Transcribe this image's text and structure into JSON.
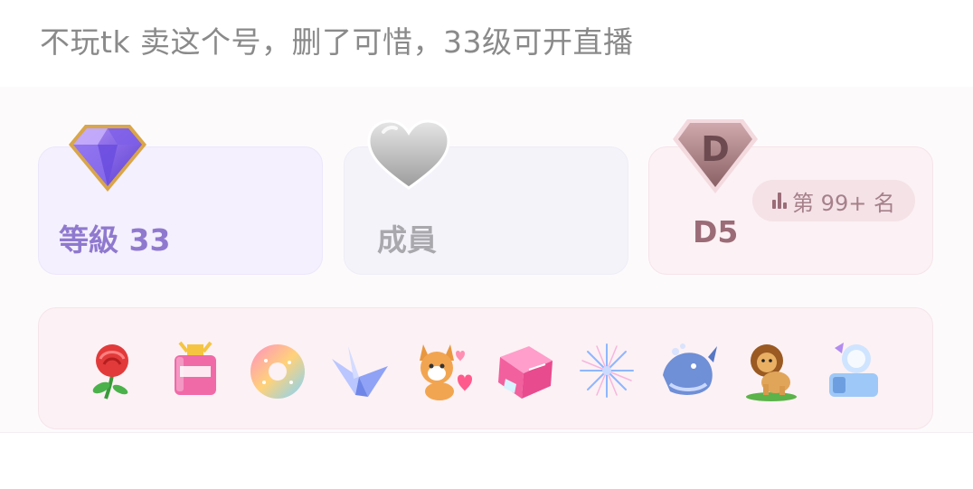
{
  "caption": "不玩tk 卖这个号，删了可惜，33级可开直播",
  "stats": {
    "level": {
      "label": "等級 33",
      "icon": "diamond-icon"
    },
    "membership": {
      "label": "成員",
      "icon": "heart-icon"
    },
    "rank": {
      "tier_letter": "D",
      "label": "D5",
      "badge": "第 99+ 名",
      "icon": "shield-icon"
    }
  },
  "gifts": [
    {
      "name": "rose-gift-icon"
    },
    {
      "name": "perfume-gift-icon"
    },
    {
      "name": "donut-gift-icon"
    },
    {
      "name": "paper-crane-gift-icon"
    },
    {
      "name": "corgi-gift-icon"
    },
    {
      "name": "tiktok-cube-gift-icon"
    },
    {
      "name": "fireworks-gift-icon"
    },
    {
      "name": "whale-gift-icon"
    },
    {
      "name": "lion-gift-icon"
    },
    {
      "name": "crystal-gift-icon"
    }
  ],
  "colors": {
    "level_accent": "#8f79cf",
    "rank_accent": "#9b6c78",
    "member_text": "#a9a9ad",
    "caption_text": "#8a8a8a"
  }
}
